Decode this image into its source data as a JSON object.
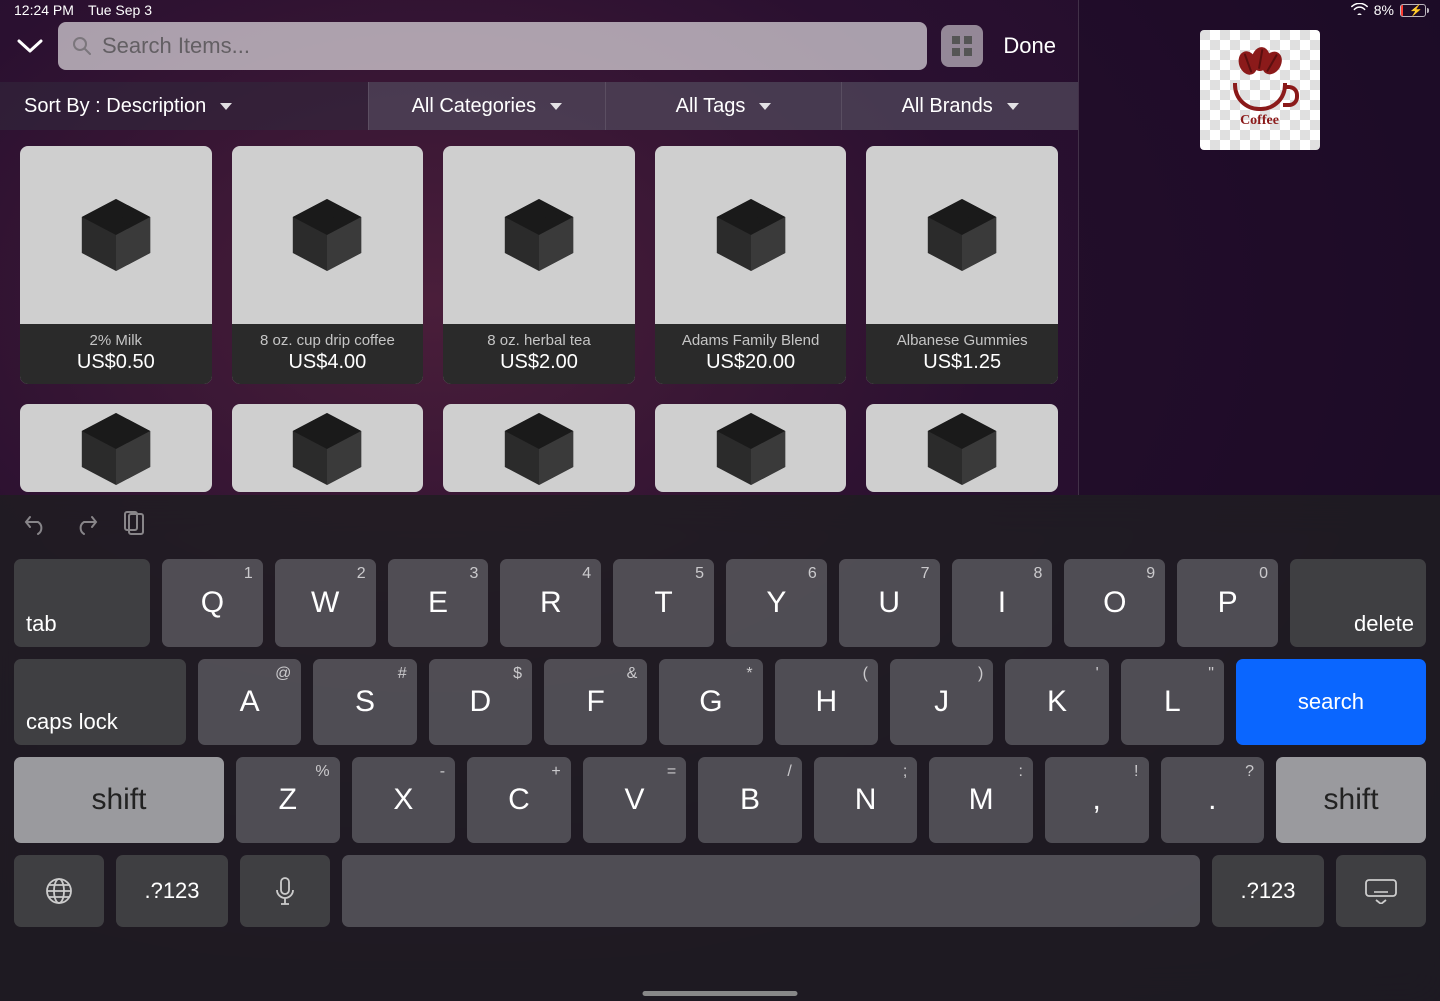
{
  "status": {
    "time": "12:24 PM",
    "date": "Tue Sep 3",
    "battery_pct": "8%"
  },
  "topbar": {
    "search_placeholder": "Search Items...",
    "done_label": "Done"
  },
  "filters": {
    "sort_label": "Sort By : Description",
    "categories_label": "All Categories",
    "tags_label": "All Tags",
    "brands_label": "All Brands"
  },
  "products": [
    {
      "name": "2% Milk",
      "price": "US$0.50"
    },
    {
      "name": "8 oz. cup drip coffee",
      "price": "US$4.00"
    },
    {
      "name": "8 oz. herbal tea",
      "price": "US$2.00"
    },
    {
      "name": "Adams Family Blend",
      "price": "US$20.00"
    },
    {
      "name": "Albanese Gummies",
      "price": "US$1.25"
    }
  ],
  "side_logo_text": "Coffee",
  "keyboard": {
    "row1": {
      "tab": "tab",
      "keys": [
        {
          "sub": "1",
          "main": "Q"
        },
        {
          "sub": "2",
          "main": "W"
        },
        {
          "sub": "3",
          "main": "E"
        },
        {
          "sub": "4",
          "main": "R"
        },
        {
          "sub": "5",
          "main": "T"
        },
        {
          "sub": "6",
          "main": "Y"
        },
        {
          "sub": "7",
          "main": "U"
        },
        {
          "sub": "8",
          "main": "I"
        },
        {
          "sub": "9",
          "main": "O"
        },
        {
          "sub": "0",
          "main": "P"
        }
      ],
      "delete": "delete"
    },
    "row2": {
      "caps": "caps lock",
      "keys": [
        {
          "sub": "@",
          "main": "A"
        },
        {
          "sub": "#",
          "main": "S"
        },
        {
          "sub": "$",
          "main": "D"
        },
        {
          "sub": "&",
          "main": "F"
        },
        {
          "sub": "*",
          "main": "G"
        },
        {
          "sub": "(",
          "main": "H"
        },
        {
          "sub": ")",
          "main": "J"
        },
        {
          "sub": "'",
          "main": "K"
        },
        {
          "sub": "\"",
          "main": "L"
        }
      ],
      "search": "search"
    },
    "row3": {
      "shiftL": "shift",
      "keys": [
        {
          "sub": "%",
          "main": "Z"
        },
        {
          "sub": "-",
          "main": "X"
        },
        {
          "sub": "+",
          "main": "C"
        },
        {
          "sub": "=",
          "main": "V"
        },
        {
          "sub": "/",
          "main": "B"
        },
        {
          "sub": ";",
          "main": "N"
        },
        {
          "sub": ":",
          "main": "M"
        },
        {
          "sub": "!",
          "main": ","
        },
        {
          "sub": "?",
          "main": "."
        }
      ],
      "shiftR": "shift"
    },
    "row4": {
      "numeric": ".?123"
    }
  }
}
